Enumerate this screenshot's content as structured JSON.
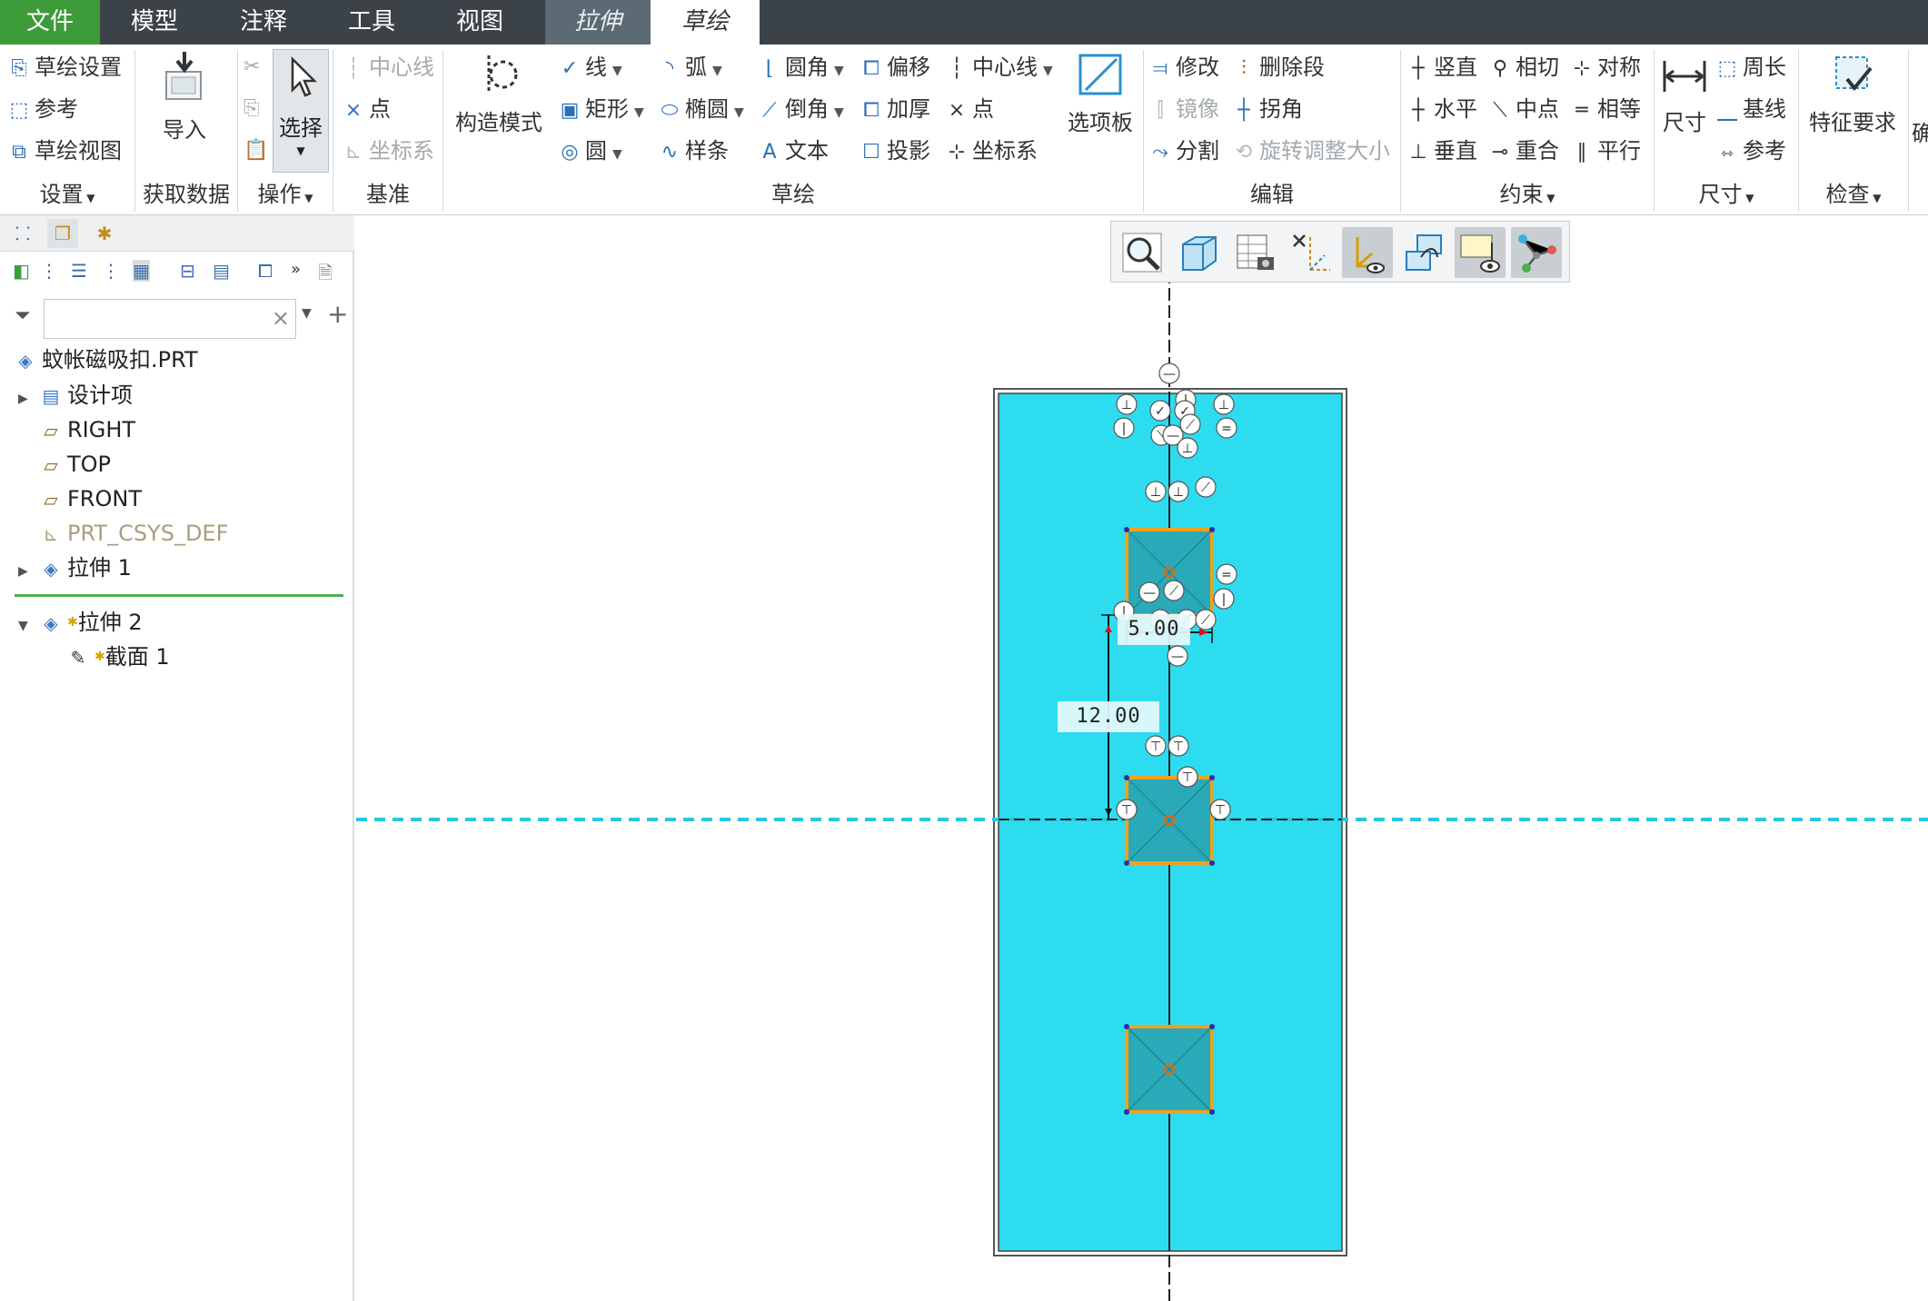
{
  "tabs": {
    "file": "文件",
    "model": "模型",
    "annotate": "注释",
    "tools": "工具",
    "view": "视图",
    "extrude": "拉伸",
    "sketch": "草绘"
  },
  "ribbon": {
    "setup": {
      "sketch_setup": "草绘设置",
      "references": "参考",
      "sketch_view": "草绘视图",
      "label": "设置"
    },
    "get_data": {
      "import": "导入",
      "label": "获取数据"
    },
    "operations": {
      "select": "选择",
      "label": "操作"
    },
    "datum": {
      "centerline": "中心线",
      "point": "点",
      "csys": "坐标系",
      "label": "基准"
    },
    "construction": {
      "mode": "构造模式"
    },
    "sketching": {
      "line": "线",
      "arc": "弧",
      "fillet": "圆角",
      "offset": "偏移",
      "centerline": "中心线",
      "rectangle": "矩形",
      "ellipse": "椭圆",
      "chamfer": "倒角",
      "thicken": "加厚",
      "point": "点",
      "circle": "圆",
      "spline": "样条",
      "text": "文本",
      "project": "投影",
      "csys": "坐标系",
      "palette": "选项板",
      "label": "草绘"
    },
    "editing": {
      "modify": "修改",
      "delete_segment": "删除段",
      "mirror": "镜像",
      "corner": "拐角",
      "divide": "分割",
      "rotate_resize": "旋转调整大小",
      "label": "编辑"
    },
    "constrain": {
      "vertical": "竖直",
      "tangent": "相切",
      "symmetric": "对称",
      "horizontal": "水平",
      "midpoint": "中点",
      "equal": "相等",
      "perpendicular": "垂直",
      "coincident": "重合",
      "parallel": "平行",
      "label": "约束"
    },
    "dimension": {
      "dimension": "尺寸",
      "perimeter": "周长",
      "baseline": "基线",
      "reference": "参考",
      "label": "尺寸"
    },
    "inspect": {
      "feature_requirements": "特征要求",
      "label": "检查",
      "cut_label": "确"
    }
  },
  "tree": {
    "filter_placeholder": "",
    "filter_clear": "×",
    "items": [
      {
        "label": "蚊帐磁吸扣.PRT"
      },
      {
        "label": "设计项"
      },
      {
        "label": "RIGHT"
      },
      {
        "label": "TOP"
      },
      {
        "label": "FRONT"
      },
      {
        "label": "PRT_CSYS_DEF"
      },
      {
        "label": "拉伸 1"
      },
      {
        "label": "拉伸 2"
      },
      {
        "label": "截面 1"
      }
    ]
  },
  "sketch": {
    "dimensions": [
      "5.00",
      "12.00"
    ]
  },
  "colors": {
    "tabbar": "#3c4348",
    "file_tab": "#3e9b3a",
    "part_face": "#2ddcef",
    "sketch_rect_fill": "#2aa9b8",
    "sketch_rect_edge": "#f0a21c",
    "datum_dashed": "#27c8e0",
    "tree_separator": "#4caf50"
  }
}
